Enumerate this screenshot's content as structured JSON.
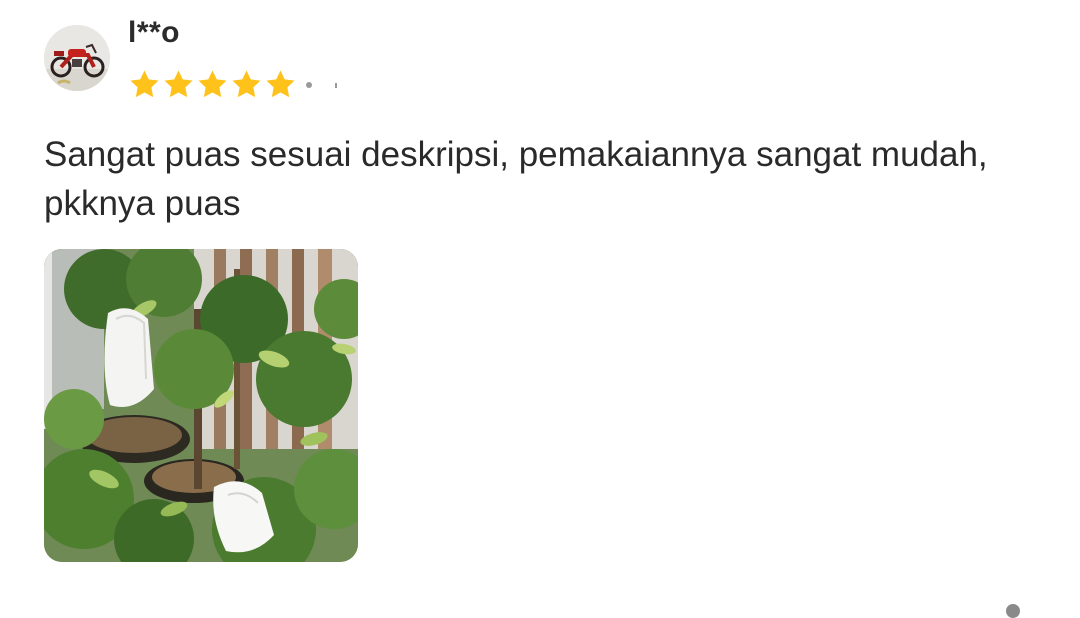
{
  "review": {
    "username": "l**o",
    "rating": 5,
    "rating_max": 5,
    "text": "Sangat puas sesuai deskripsi, pemakaiannya sangat mudah, pkknya puas",
    "avatar_icon": "motorcycle-avatar",
    "photo_icon": "plant-photo",
    "star_color": "#FFC21A",
    "text_color": "#2A2A2A"
  }
}
